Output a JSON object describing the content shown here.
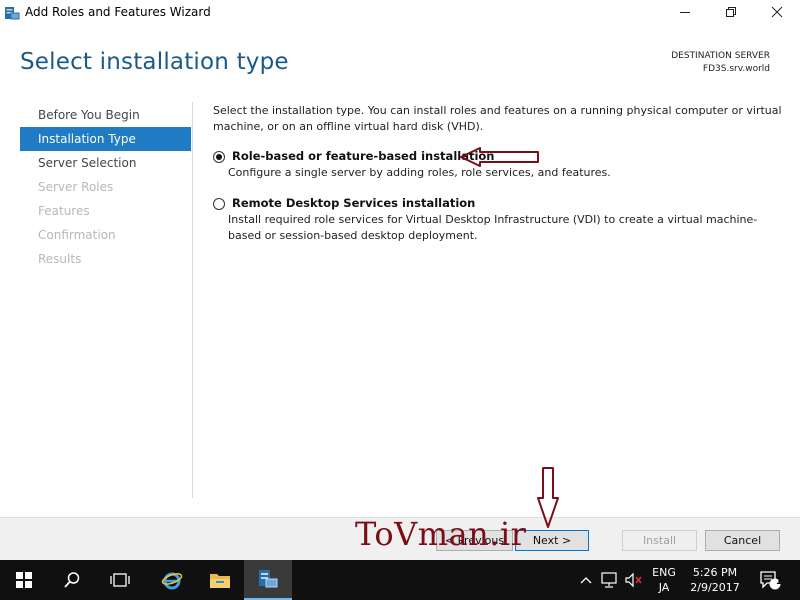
{
  "window": {
    "title": "Add Roles and Features Wizard"
  },
  "header": {
    "page_title": "Select installation type",
    "destination_label": "DESTINATION SERVER",
    "destination_server": "FD3S.srv.world"
  },
  "nav": {
    "items": [
      {
        "label": "Before You Begin",
        "state": "enabled"
      },
      {
        "label": "Installation Type",
        "state": "active"
      },
      {
        "label": "Server Selection",
        "state": "enabled"
      },
      {
        "label": "Server Roles",
        "state": "disabled"
      },
      {
        "label": "Features",
        "state": "disabled"
      },
      {
        "label": "Confirmation",
        "state": "disabled"
      },
      {
        "label": "Results",
        "state": "disabled"
      }
    ]
  },
  "main": {
    "intro": "Select the installation type. You can install roles and features on a running physical computer or virtual machine, or on an offline virtual hard disk (VHD).",
    "options": [
      {
        "label": "Role-based or feature-based installation",
        "description": "Configure a single server by adding roles, role services, and features.",
        "checked": true
      },
      {
        "label": "Remote Desktop Services installation",
        "description": "Install required role services for Virtual Desktop Infrastructure (VDI) to create a virtual machine-based or session-based desktop deployment.",
        "checked": false
      }
    ]
  },
  "footer": {
    "previous_label": "< Previous",
    "next_label": "Next >",
    "install_label": "Install",
    "cancel_label": "Cancel",
    "watermark": "ToVman.ir"
  },
  "taskbar": {
    "language_top": "ENG",
    "language_bottom": "JA",
    "time": "5:26 PM",
    "date": "2/9/2017",
    "notification_count": "1"
  },
  "colors": {
    "accent": "#1e7bc4",
    "title_blue": "#1a5a8a",
    "annotation": "#7b0f17",
    "taskbar": "#101010"
  }
}
